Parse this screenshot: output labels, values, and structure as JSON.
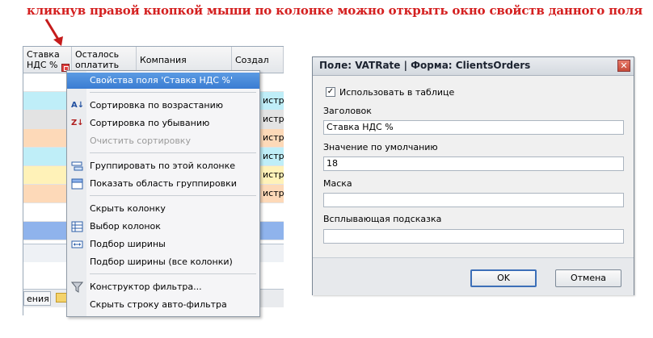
{
  "caption": "кликнув правой кнопкой мыши по колонке можно открыть окно свойств данного поля",
  "grid": {
    "columns": [
      "Ставка\nНДС %",
      "Осталось\nоплатить",
      "Компания",
      "Создал"
    ],
    "row_tail": "истра",
    "tab_label": "ения"
  },
  "menu": {
    "items": [
      {
        "label": "Свойства поля 'Ставка НДС %'",
        "icon": "field-properties-icon"
      },
      {
        "label": "Сортировка по возрастанию",
        "icon": "sort-ascending-icon"
      },
      {
        "label": "Сортировка по убыванию",
        "icon": "sort-descending-icon"
      },
      {
        "label": "Очистить сортировку",
        "icon": ""
      },
      {
        "label": "Группировать по этой колонке",
        "icon": "group-by-column-icon"
      },
      {
        "label": "Показать область группировки",
        "icon": "group-area-icon"
      },
      {
        "label": "Скрыть колонку",
        "icon": ""
      },
      {
        "label": "Выбор колонок",
        "icon": "column-chooser-icon"
      },
      {
        "label": "Подбор ширины",
        "icon": "best-fit-icon"
      },
      {
        "label": "Подбор ширины (все колонки)",
        "icon": ""
      },
      {
        "label": "Конструктор фильтра...",
        "icon": "filter-builder-icon"
      },
      {
        "label": "Скрыть строку авто-фильтра",
        "icon": ""
      }
    ]
  },
  "dialog": {
    "title": "Поле: VATRate | Форма: ClientsOrders",
    "use_in_table_label": "Использовать в таблице",
    "use_in_table_checked": true,
    "caption_label": "Заголовок",
    "caption_value": "Ставка НДС %",
    "default_label": "Значение по умолчанию",
    "default_value": "18",
    "mask_label": "Маска",
    "mask_value": "",
    "tooltip_label": "Всплывающая подсказка",
    "tooltip_value": "",
    "ok_label": "OK",
    "cancel_label": "Отмена"
  },
  "colors": {
    "caption": "#d42020",
    "highlight": "#3a7cd2"
  }
}
